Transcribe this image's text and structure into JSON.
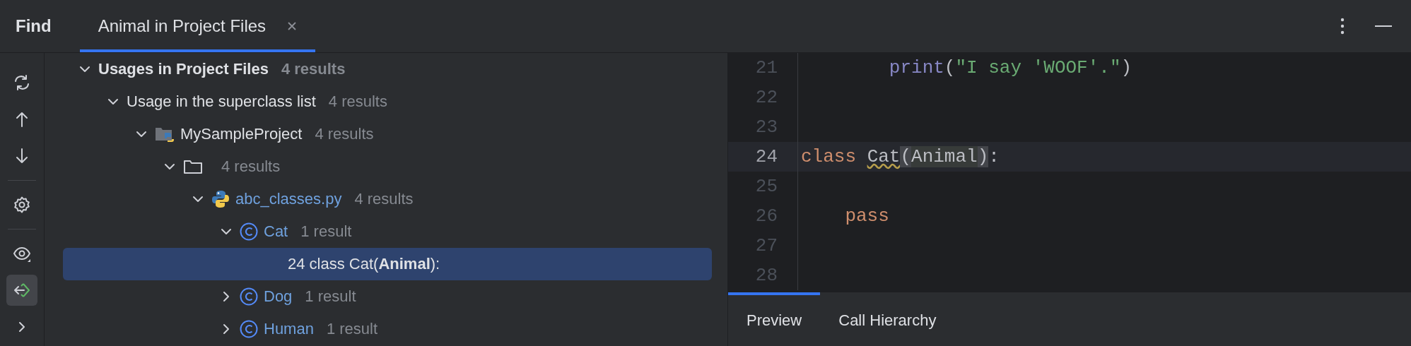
{
  "header": {
    "title": "Find",
    "tabs": [
      {
        "label": "Animal in Project Files",
        "selected": true,
        "closable": true
      }
    ]
  },
  "toolbar": {
    "items": [
      {
        "kind": "rerun",
        "selected": false
      },
      {
        "kind": "up",
        "selected": false
      },
      {
        "kind": "down",
        "selected": false
      },
      {
        "kind": "separator"
      },
      {
        "kind": "settings",
        "selected": false
      },
      {
        "kind": "separator"
      },
      {
        "kind": "preview",
        "selected": false
      },
      {
        "kind": "navigate",
        "selected": true
      },
      {
        "kind": "more",
        "selected": false
      }
    ]
  },
  "tree": [
    {
      "kind": "group",
      "label": "Usages in Project Files",
      "count": "4 results",
      "expanded": true,
      "selected": false,
      "children": [
        {
          "kind": "category",
          "label": "Usage in the superclass list",
          "count": "4 results",
          "expanded": true,
          "selected": false,
          "children": [
            {
              "kind": "project",
              "label": "MySampleProject",
              "count": "4 results",
              "expanded": true,
              "selected": false,
              "children": [
                {
                  "kind": "folder",
                  "count": "4 results",
                  "expanded": true,
                  "selected": false,
                  "children": [
                    {
                      "kind": "file",
                      "label": "abc_classes.py",
                      "count": "4 results",
                      "expanded": true,
                      "selected": false,
                      "children": [
                        {
                          "kind": "class",
                          "label": "Cat",
                          "count": "1 result",
                          "expanded": true,
                          "selected": false,
                          "children": [
                            {
                              "kind": "usage",
                              "label": "24 class Cat(**Animal**):",
                              "selected": true
                            }
                          ]
                        },
                        {
                          "kind": "class",
                          "label": "Dog",
                          "count": "1 result",
                          "expanded": false,
                          "selected": false
                        },
                        {
                          "kind": "class",
                          "label": "Human",
                          "count": "1 result",
                          "expanded": false,
                          "selected": false
                        }
                      ]
                    }
                  ]
                }
              ]
            }
          ]
        }
      ]
    }
  ],
  "editor": {
    "lines": [
      {
        "number": "21",
        "current": false,
        "tokens": [
          {
            "kind": "builtin",
            "text": "        print"
          },
          {
            "kind": "plain",
            "text": "("
          },
          {
            "kind": "string",
            "text": "\"I say 'WOOF'.\""
          },
          {
            "kind": "plain",
            "text": ")"
          }
        ]
      },
      {
        "number": "22",
        "current": false
      },
      {
        "number": "23",
        "current": false
      },
      {
        "number": "24",
        "current": true,
        "tokens": [
          {
            "kind": "keyword",
            "text": "class "
          },
          {
            "kind": "warning",
            "text": "Cat"
          },
          {
            "kind": "brace",
            "text": "("
          },
          {
            "kind": "match",
            "text": "Animal"
          },
          {
            "kind": "brace",
            "text": ")"
          },
          {
            "kind": "plain",
            "text": ":"
          }
        ]
      },
      {
        "number": "25",
        "current": false
      },
      {
        "number": "26",
        "current": false,
        "tokens": [
          {
            "kind": "keyword",
            "text": "    pass"
          }
        ]
      },
      {
        "number": "27",
        "current": false
      },
      {
        "number": "28",
        "current": false
      }
    ],
    "tabs": [
      {
        "label": "Preview",
        "selected": true
      },
      {
        "label": "Call Hierarchy",
        "selected": false
      }
    ]
  }
}
